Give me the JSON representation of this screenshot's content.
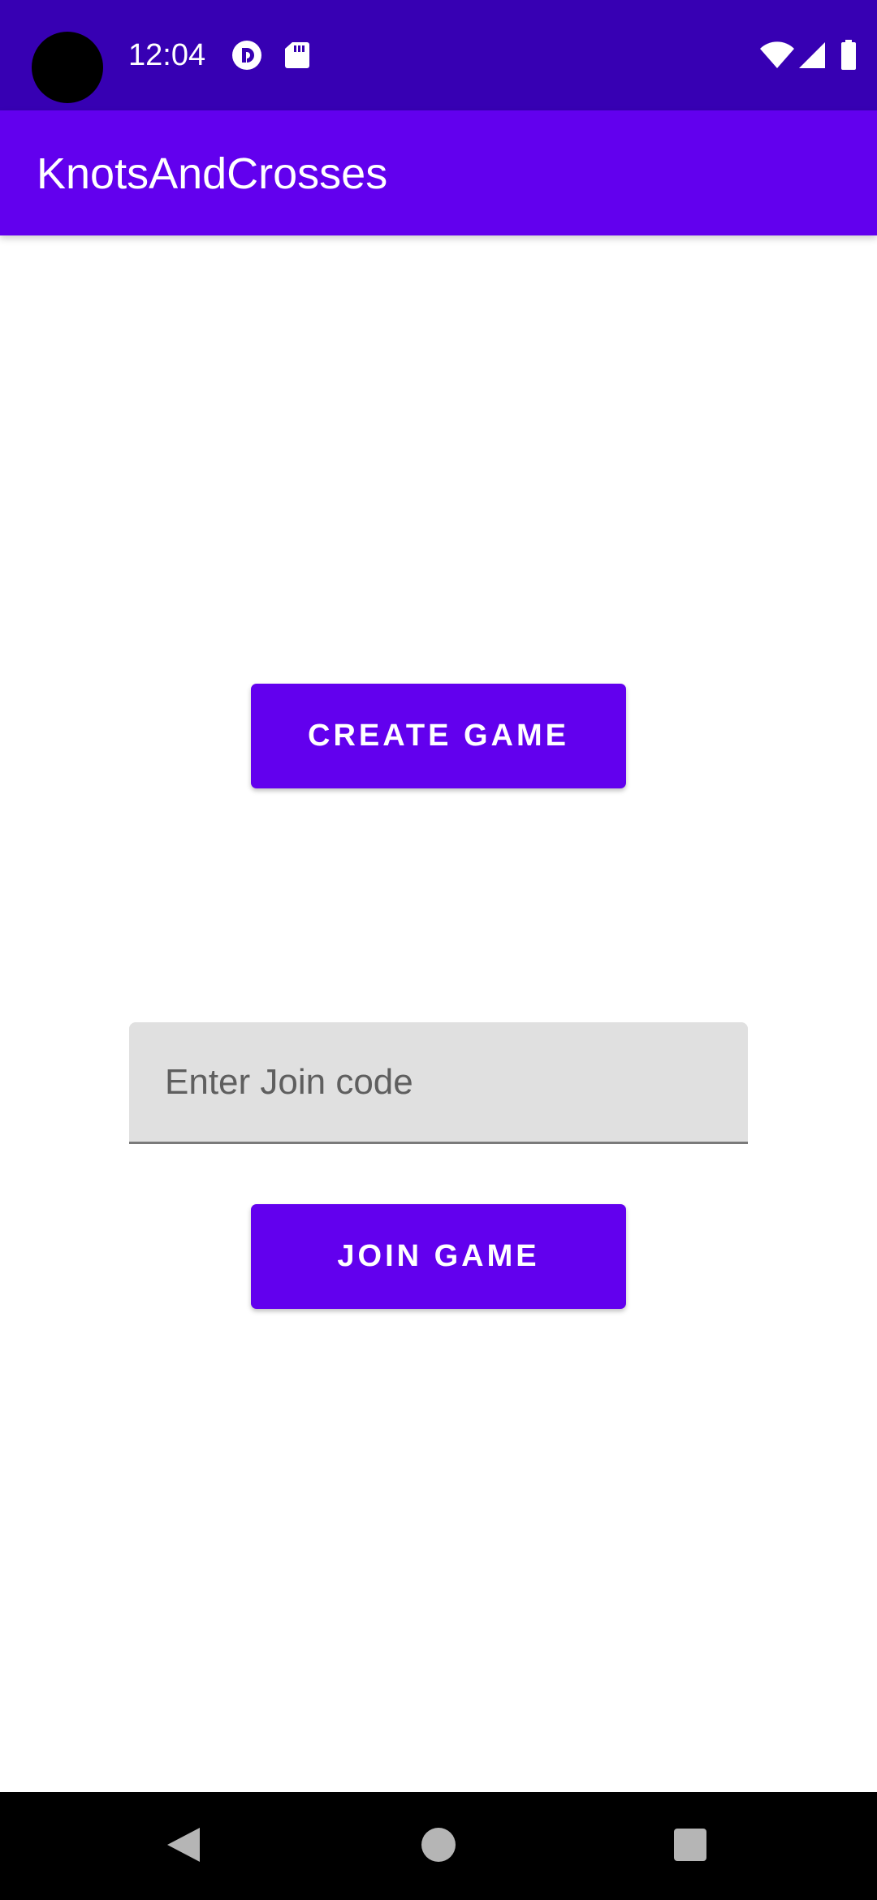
{
  "status_bar": {
    "time": "12:04",
    "icons": [
      "camera-cutout",
      "pocket-casts-icon",
      "sd-card-icon",
      "wifi-icon",
      "cell-signal-icon",
      "battery-icon"
    ]
  },
  "app_bar": {
    "title": "KnotsAndCrosses"
  },
  "main": {
    "create_button_label": "CREATE GAME",
    "join_code_placeholder": "Enter Join code",
    "join_code_value": "",
    "join_button_label": "JOIN GAME"
  },
  "nav_bar": {
    "icons": [
      "back-icon",
      "home-icon",
      "recents-icon"
    ]
  },
  "colors": {
    "status_bar": "#3700B3",
    "primary": "#6200EE",
    "input_bg": "#E0E0E0",
    "nav_bar": "#000000"
  }
}
